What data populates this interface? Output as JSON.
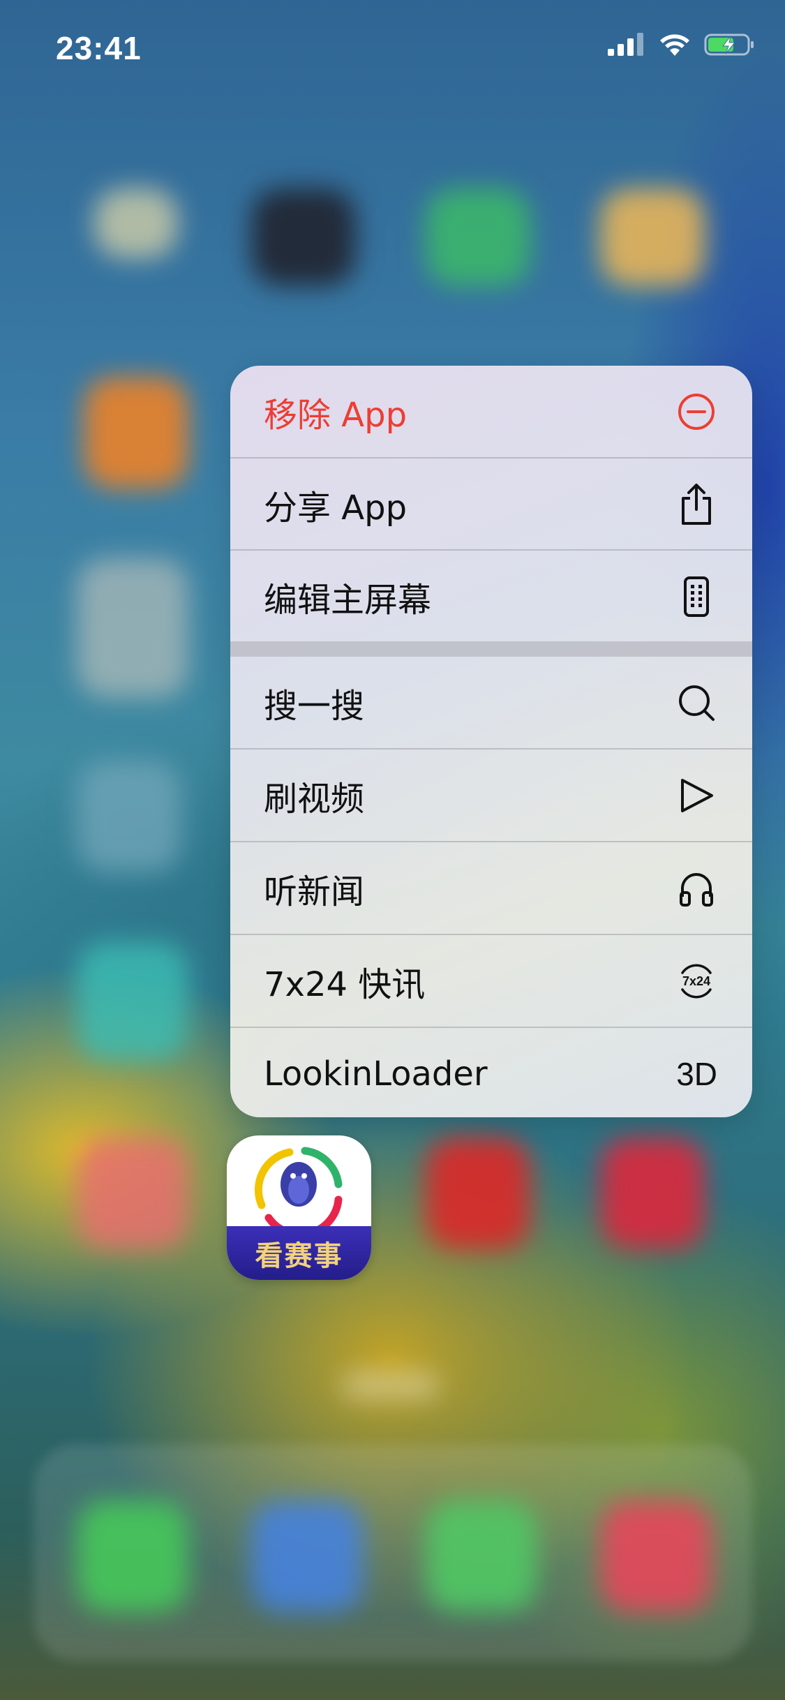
{
  "status_bar": {
    "time": "23:41"
  },
  "context_menu": {
    "items": [
      {
        "label": "移除 App",
        "icon": "minus-circle-icon",
        "style": "destructive"
      },
      {
        "label": "分享 App",
        "icon": "share-icon"
      },
      {
        "label": "编辑主屏幕",
        "icon": "phone-grid-icon"
      },
      {
        "label": "搜一搜",
        "icon": "search-icon"
      },
      {
        "label": "刷视频",
        "icon": "play-icon"
      },
      {
        "label": "听新闻",
        "icon": "headphones-icon"
      },
      {
        "label": "7x24 快讯",
        "icon": "7x24-icon",
        "icon_text": "7x24"
      },
      {
        "label": "LookinLoader",
        "icon_text": "3D"
      }
    ]
  },
  "app_icon": {
    "banner_text": "看赛事"
  },
  "colors": {
    "destructive": "#ee3d33",
    "banner": "#2b2399",
    "banner_text": "#f3d27a"
  }
}
